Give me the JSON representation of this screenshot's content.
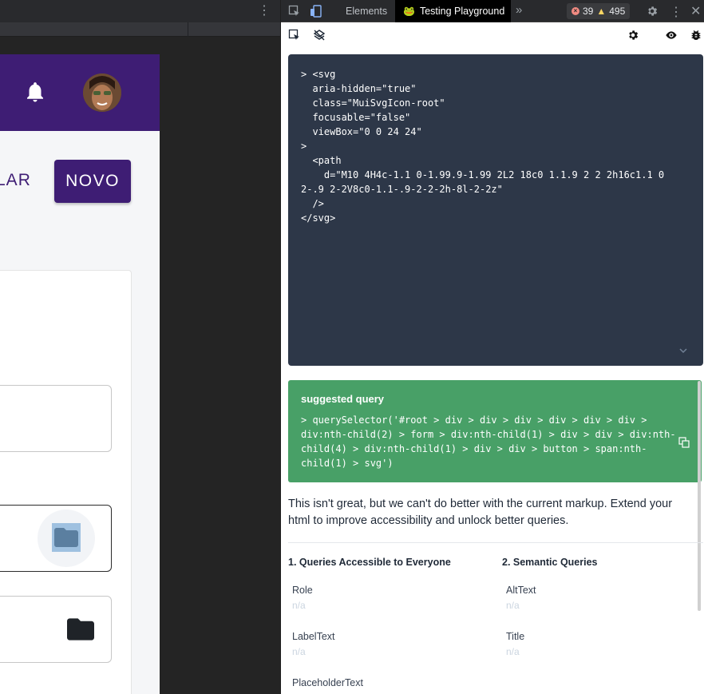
{
  "browser": {
    "page": {
      "cancel_label": "ELAR",
      "new_label": "NOVO"
    }
  },
  "devtools": {
    "tabs": [
      "Elements",
      "Testing Playground"
    ],
    "errors": "39",
    "warnings": "495",
    "code_lines": [
      "> <svg",
      "  aria-hidden=\"true\"",
      "  class=\"MuiSvgIcon-root\"",
      "  focusable=\"false\"",
      "  viewBox=\"0 0 24 24\"",
      ">",
      "  <path",
      "    d=\"M10 4H4c-1.1 0-1.99.9-1.99 2L2 18c0 1.1.9 2 2 2h16c1.1 0",
      "2-.9 2-2V8c0-1.1-.9-2-2-2h-8l-2-2z\"",
      "  />",
      "</svg>"
    ],
    "suggested": {
      "title": "suggested query",
      "query_lines": [
        "> querySelector('#root > div > div > div > div > div > div >",
        "div:nth-child(2) > form > div:nth-child(1) > div > div > div:nth-",
        "child(4) > div:nth-child(1) > div > div > button > span:nth-",
        "child(1) > svg')"
      ]
    },
    "hint": "This isn't great, but we can't do better with the current markup. Extend your html to improve accessibility and unlock better queries.",
    "columns": {
      "accessible": {
        "title": "1. Queries Accessible to Everyone",
        "items": [
          {
            "label": "Role",
            "value": "n/a"
          },
          {
            "label": "LabelText",
            "value": "n/a"
          },
          {
            "label": "PlaceholderText",
            "value": ""
          }
        ]
      },
      "semantic": {
        "title": "2. Semantic Queries",
        "items": [
          {
            "label": "AltText",
            "value": "n/a"
          },
          {
            "label": "Title",
            "value": "n/a"
          }
        ]
      }
    }
  },
  "icons": {
    "bell": "bell-icon",
    "folder": "folder-icon",
    "inspect": "inspect-icon",
    "device": "device-toolbar-icon",
    "gear": "gear-icon",
    "eye": "eye-icon",
    "bug": "bug-icon",
    "copy": "copy-icon"
  },
  "colors": {
    "appbar": "#3e1d74",
    "suggest_bg": "#48a067",
    "code_bg": "#2d3748"
  }
}
